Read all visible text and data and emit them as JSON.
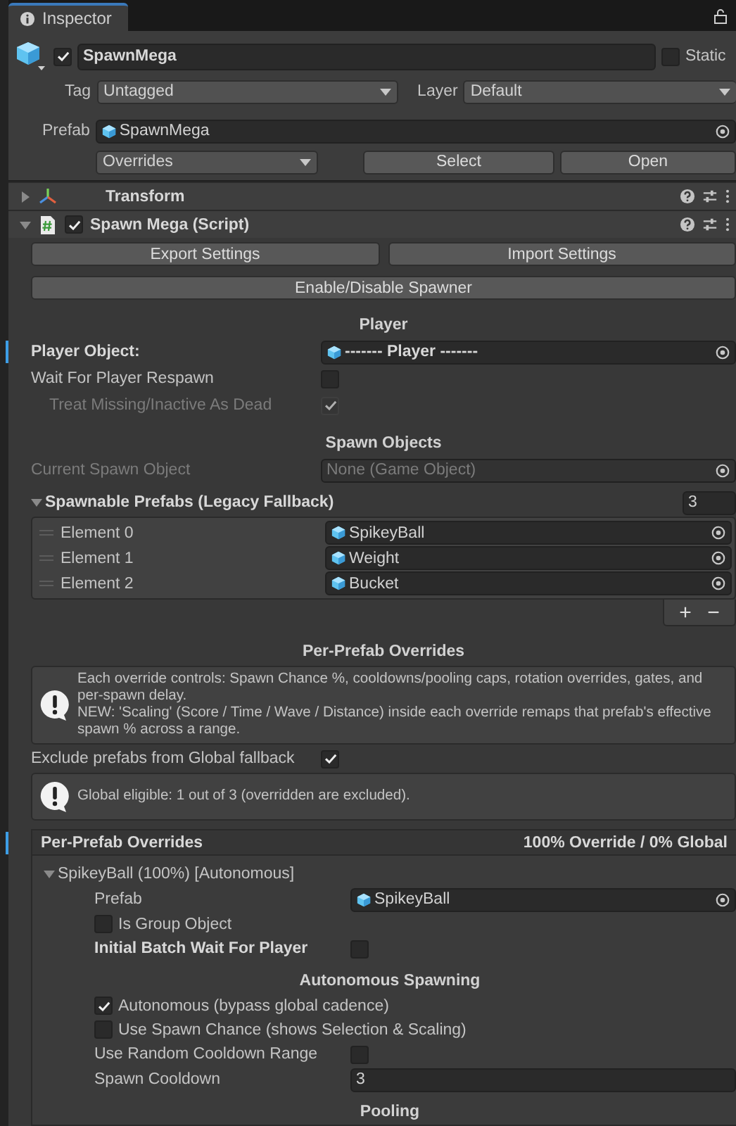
{
  "tab": {
    "label": "Inspector",
    "selected": true
  },
  "object": {
    "active": true,
    "name": "SpawnMega",
    "static": false,
    "static_label": "Static",
    "tag_label": "Tag",
    "tag": "Untagged",
    "layer_label": "Layer",
    "layer": "Default",
    "prefab_label": "Prefab",
    "prefab": "SpawnMega",
    "overrides": "Overrides",
    "select": "Select",
    "open": "Open"
  },
  "components": [
    {
      "kind": "transform",
      "title": "Transform",
      "expanded": false
    },
    {
      "kind": "script",
      "title": "Spawn Mega (Script)",
      "expanded": true,
      "enabled": true
    }
  ],
  "body": [
    {
      "kind": "button_pair",
      "buttons": [
        "Export Settings",
        "Import Settings"
      ]
    },
    {
      "kind": "button",
      "label": "Enable/Disable Spawner"
    },
    {
      "kind": "header",
      "text": "Player"
    },
    {
      "kind": "object",
      "label": "Player Object:",
      "value": "------- Player -------",
      "overridden": true,
      "disabled": false,
      "has_icon": true
    },
    {
      "kind": "toggle",
      "label": "Wait For Player Respawn",
      "checked": false,
      "disabled": false,
      "overridden": false,
      "children": [
        {
          "kind": "toggle",
          "label": "Treat Missing/Inactive As Dead",
          "checked": true,
          "disabled": true,
          "overridden": false
        }
      ]
    },
    {
      "kind": "header",
      "text": "Spawn Objects"
    },
    {
      "kind": "object",
      "label": "Current Spawn Object",
      "value": "None (Game Object)",
      "overridden": false,
      "disabled": true,
      "has_icon": false
    },
    {
      "kind": "foldout_count",
      "label": "Spawnable Prefabs (Legacy Fallback)",
      "count": "3",
      "expanded": true
    },
    {
      "kind": "list",
      "elements": [
        {
          "label": "Element 0",
          "value": "SpikeyBall"
        },
        {
          "label": "Element 1",
          "value": "Weight"
        },
        {
          "label": "Element 2",
          "value": "Bucket"
        }
      ]
    },
    {
      "kind": "list_footer",
      "buttons": [
        "+",
        "−"
      ]
    },
    {
      "kind": "header",
      "text": "Per-Prefab Overrides"
    },
    {
      "kind": "help",
      "lines": [
        "Each override controls: Spawn Chance %, cooldowns/pooling caps, rotation overrides, gates, and per-spawn delay.",
        "NEW: 'Scaling' (Score / Time / Wave / Distance) inside each override remaps that prefab's effective spawn % across a range."
      ]
    },
    {
      "kind": "toggle",
      "label": "Exclude prefabs from Global fallback",
      "checked": true,
      "disabled": false,
      "overridden": false
    },
    {
      "kind": "help",
      "lines": [
        "Global eligible: 1 out of 3 (overridden are excluded)."
      ]
    },
    {
      "kind": "panel",
      "title": "Per-Prefab Overrides",
      "summary": "100% Override / 0% Global",
      "overridden": true,
      "items": [
        {
          "kind": "foldout",
          "label": "SpikeyBall  (100%)  [Autonomous]",
          "expanded": true
        },
        {
          "kind": "object",
          "label": "Prefab",
          "value": "SpikeyBall",
          "overridden": false,
          "disabled": false,
          "has_icon": true
        },
        {
          "kind": "toggle_left",
          "label": "Is Group Object",
          "checked": false
        },
        {
          "kind": "toggle",
          "label": "Initial Batch Wait For Player",
          "checked": false,
          "disabled": false,
          "overridden": true
        },
        {
          "kind": "header",
          "text": "Autonomous Spawning"
        },
        {
          "kind": "toggle_left",
          "label": "Autonomous (bypass global cadence)",
          "checked": true
        },
        {
          "kind": "toggle_left",
          "label": "Use Spawn Chance (shows Selection & Scaling)",
          "checked": false
        },
        {
          "kind": "toggle",
          "label": "Use Random Cooldown Range",
          "checked": false,
          "disabled": false,
          "overridden": false
        },
        {
          "kind": "number",
          "label": "Spawn Cooldown",
          "value": "3"
        },
        {
          "kind": "header",
          "text": "Pooling"
        }
      ]
    }
  ]
}
